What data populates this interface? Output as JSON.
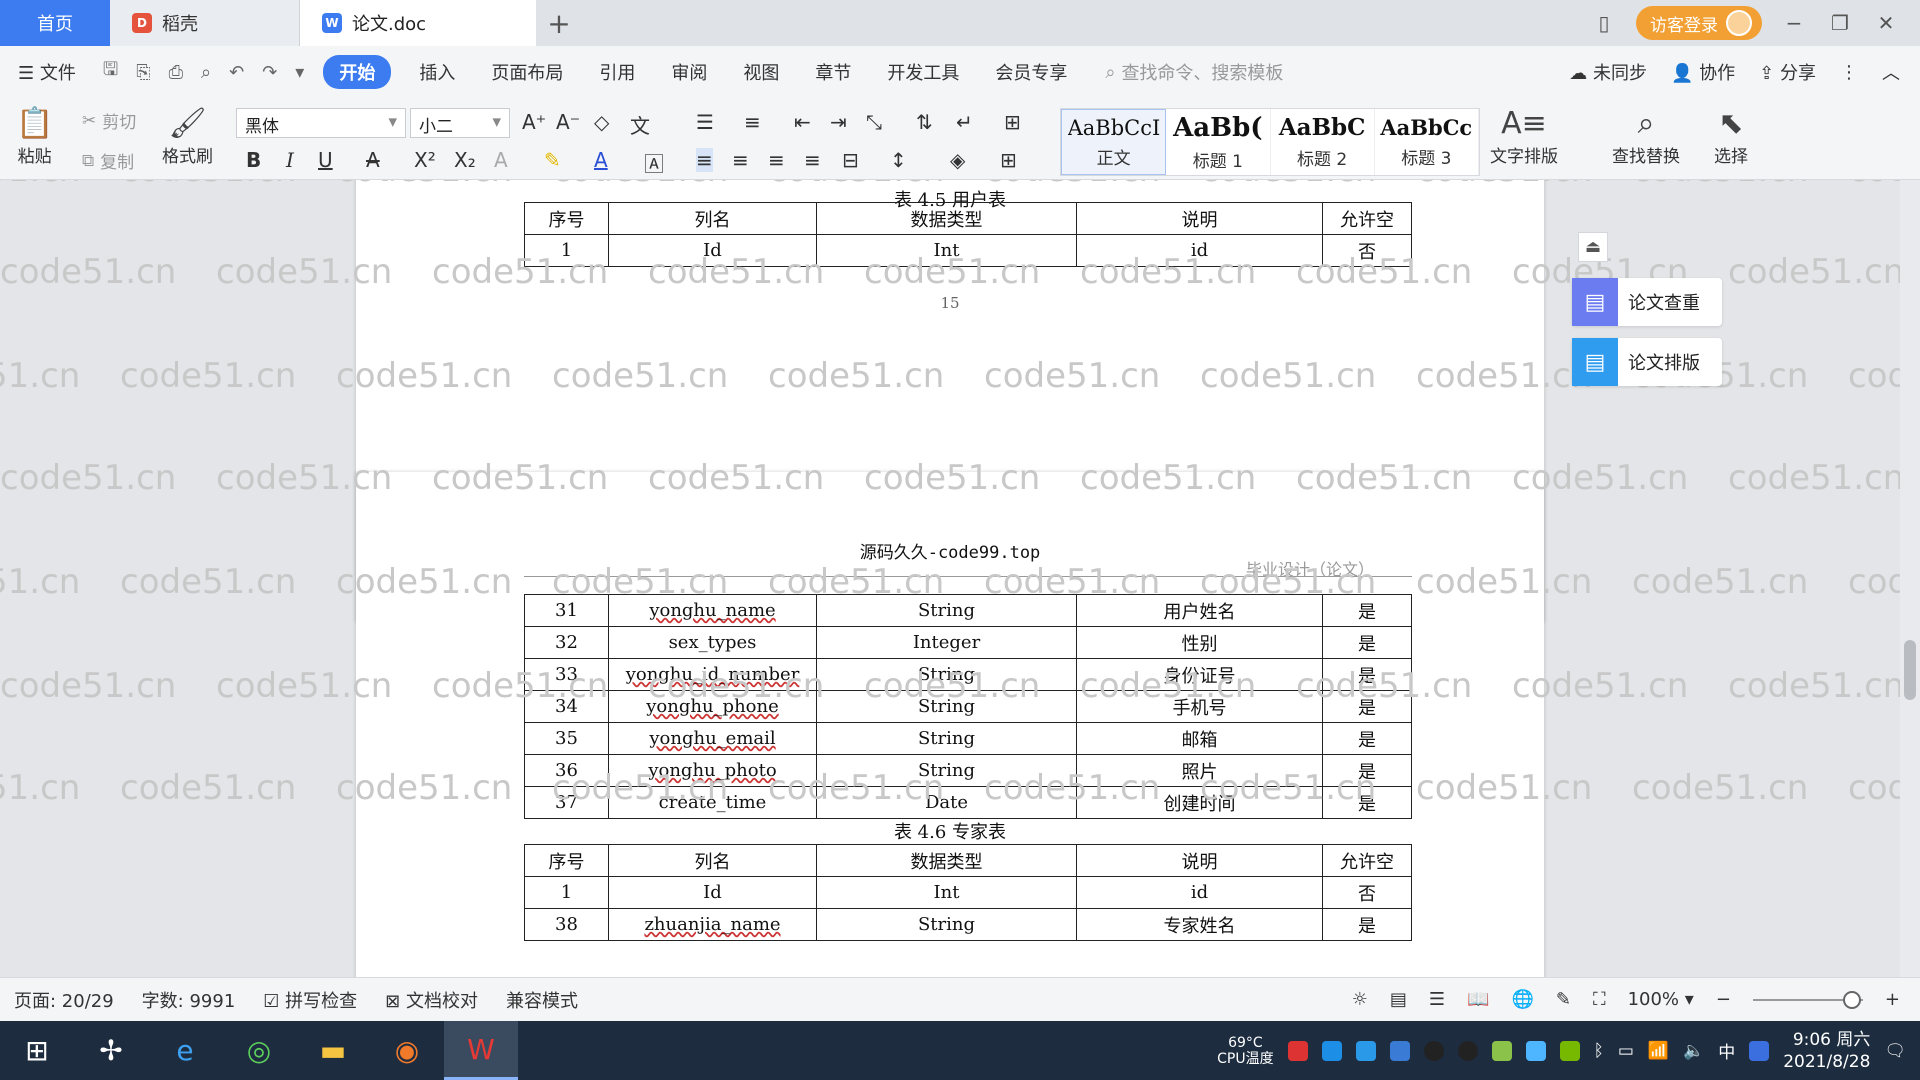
{
  "tabs": {
    "home": "首页",
    "daoke": "稻壳",
    "doc": "论文.doc"
  },
  "titlebar": {
    "login": "访客登录"
  },
  "menu": {
    "file": "文件",
    "items": [
      "开始",
      "插入",
      "页面布局",
      "引用",
      "审阅",
      "视图",
      "章节",
      "开发工具",
      "会员专享"
    ],
    "search_placeholder": "查找命令、搜索模板",
    "sync": "未同步",
    "collab": "协作",
    "share": "分享"
  },
  "ribbon": {
    "paste": "粘贴",
    "cut": "剪切",
    "copy": "复制",
    "format_painter": "格式刷",
    "font": "黑体",
    "size": "小二",
    "styles": [
      {
        "preview": "AaBbCcI",
        "name": "正文"
      },
      {
        "preview": "AaBb(",
        "name": "标题 1"
      },
      {
        "preview": "AaBbC",
        "name": "标题 2"
      },
      {
        "preview": "AaBbCcI",
        "name": "标题 3"
      }
    ],
    "text_layout": "文字排版",
    "find_replace": "查找替换",
    "select": "选择"
  },
  "document": {
    "table_user_caption": "表 4.5 用户表",
    "headers": [
      "序号",
      "列名",
      "数据类型",
      "说明",
      "允许空"
    ],
    "user_rows": [
      [
        "1",
        "Id",
        "Int",
        "id",
        "否"
      ]
    ],
    "page_number": "15",
    "page_header": "源码久久-code99.top",
    "page_header_right": "毕业设计（论文）",
    "user_rows_cont": [
      [
        "31",
        "yonghu_name",
        "String",
        "用户姓名",
        "是"
      ],
      [
        "32",
        "sex_types",
        "Integer",
        "性别",
        "是"
      ],
      [
        "33",
        "yonghu_id_number",
        "String",
        "身份证号",
        "是"
      ],
      [
        "34",
        "yonghu_phone",
        "String",
        "手机号",
        "是"
      ],
      [
        "35",
        "yonghu_email",
        "String",
        "邮箱",
        "是"
      ],
      [
        "36",
        "yonghu_photo",
        "String",
        "照片",
        "是"
      ],
      [
        "37",
        "create_time",
        "Date",
        "创建时间",
        "是"
      ]
    ],
    "table_expert_caption": "表 4.6 专家表",
    "expert_rows": [
      [
        "1",
        "Id",
        "Int",
        "id",
        "否"
      ],
      [
        "38",
        "zhuanjia_name",
        "String",
        "专家姓名",
        "是"
      ]
    ],
    "watermark": "code51.cn"
  },
  "side_panel": {
    "check": "论文查重",
    "layout": "论文排版"
  },
  "status": {
    "page": "页面: 20/29",
    "words": "字数: 9991",
    "spell": "拼写检查",
    "proof": "文档校对",
    "compat": "兼容模式",
    "zoom": "100%"
  },
  "taskbar": {
    "cpu_temp": "69°C",
    "cpu_label": "CPU温度",
    "ime": "中",
    "time": "9:06 周六",
    "date": "2021/8/28"
  }
}
